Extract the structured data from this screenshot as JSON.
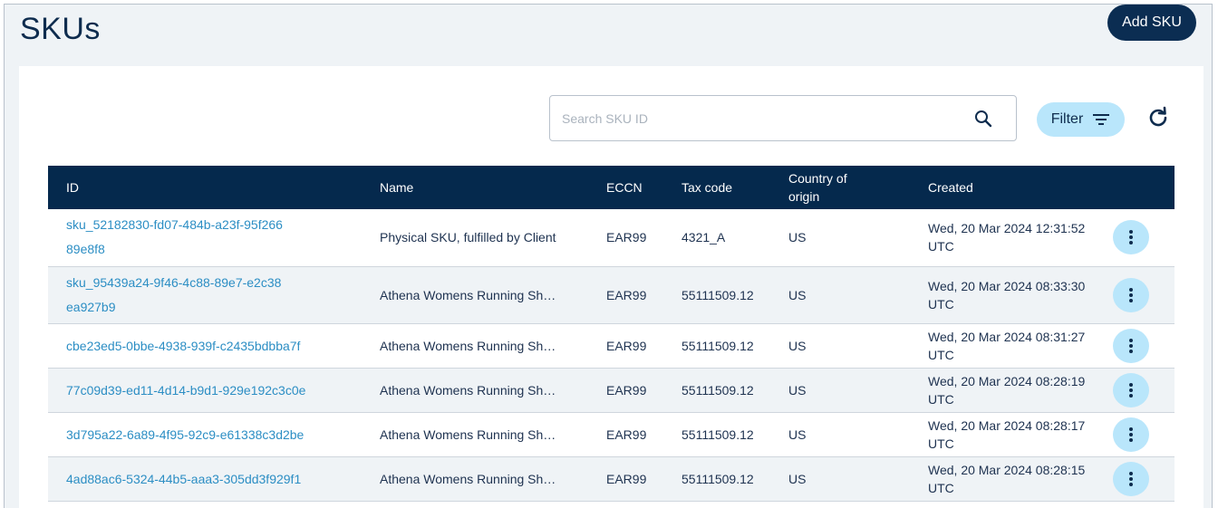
{
  "header": {
    "title": "SKUs",
    "add_label": "Add SKU"
  },
  "toolbar": {
    "search_placeholder": "Search SKU ID",
    "filter_label": "Filter"
  },
  "icons": {
    "search": "search-icon",
    "filter": "filter-icon",
    "refresh": "refresh-icon",
    "menu": "more-vertical-icon"
  },
  "colors": {
    "header_bg": "#05294d",
    "primary_button": "#0b2d52",
    "accent_button": "#b9e6fb",
    "link": "#2c8ec4"
  },
  "table": {
    "columns": [
      "ID",
      "Name",
      "ECCN",
      "Tax code",
      "Country of origin",
      "Created"
    ],
    "rows": [
      {
        "id": "sku_52182830-fd07-484b-a23f-95f26689e8f8",
        "name": "Physical SKU, fulfilled by Client",
        "eccn": "EAR99",
        "tax_code": "4321_A",
        "country": "US",
        "created": "Wed, 20 Mar 2024 12:31:52 UTC"
      },
      {
        "id": "sku_95439a24-9f46-4c88-89e7-e2c38ea927b9",
        "name": "Athena Womens Running Sh…",
        "eccn": "EAR99",
        "tax_code": "55111509.12",
        "country": "US",
        "created": "Wed, 20 Mar 2024 08:33:30 UTC"
      },
      {
        "id": "cbe23ed5-0bbe-4938-939f-c2435bdbba7f",
        "name": "Athena Womens Running Sh…",
        "eccn": "EAR99",
        "tax_code": "55111509.12",
        "country": "US",
        "created": "Wed, 20 Mar 2024 08:31:27 UTC"
      },
      {
        "id": "77c09d39-ed11-4d14-b9d1-929e192c3c0e",
        "name": "Athena Womens Running Sh…",
        "eccn": "EAR99",
        "tax_code": "55111509.12",
        "country": "US",
        "created": "Wed, 20 Mar 2024 08:28:19 UTC"
      },
      {
        "id": "3d795a22-6a89-4f95-92c9-e61338c3d2be",
        "name": "Athena Womens Running Sh…",
        "eccn": "EAR99",
        "tax_code": "55111509.12",
        "country": "US",
        "created": "Wed, 20 Mar 2024 08:28:17 UTC"
      },
      {
        "id": "4ad88ac6-5324-44b5-aaa3-305dd3f929f1",
        "name": "Athena Womens Running Sh…",
        "eccn": "EAR99",
        "tax_code": "55111509.12",
        "country": "US",
        "created": "Wed, 20 Mar 2024 08:28:15 UTC"
      }
    ]
  }
}
